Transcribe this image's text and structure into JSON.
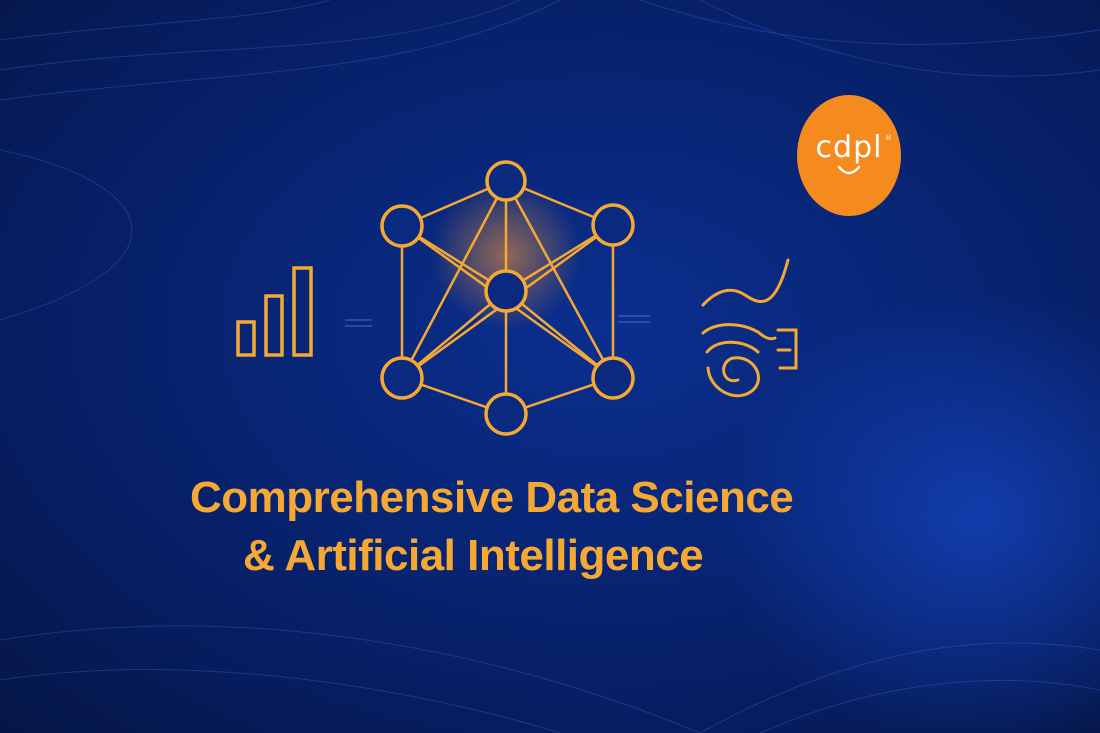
{
  "title": {
    "line1": "Comprehensive Data Science",
    "line2": "& Artificial Intelligence"
  },
  "logo": {
    "text": "cdpl",
    "mark": "®",
    "color": "#f58a1f"
  },
  "colors": {
    "accent": "#f5a833",
    "background": "#082575"
  },
  "icons": [
    "bar-chart-icon",
    "neural-network-icon",
    "data-wave-icon"
  ]
}
